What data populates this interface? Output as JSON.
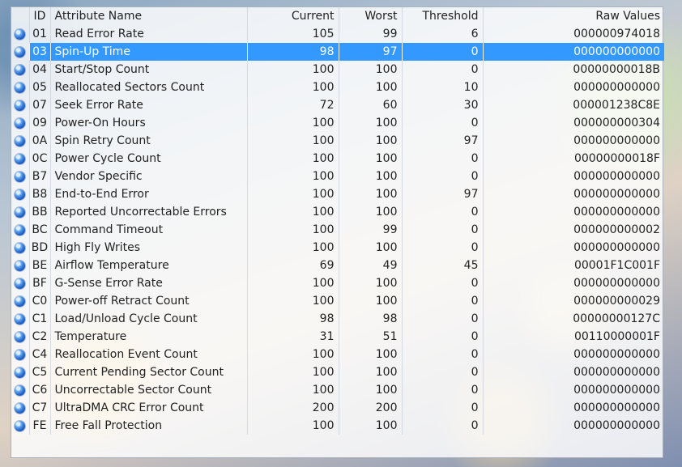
{
  "columns": {
    "id": "ID",
    "name": "Attribute Name",
    "current": "Current",
    "worst": "Worst",
    "threshold": "Threshold",
    "raw": "Raw Values"
  },
  "status_icon": "blue-status-dot",
  "selected_row": 1,
  "rows": [
    {
      "id": "01",
      "name": "Read Error Rate",
      "current": "105",
      "worst": "99",
      "threshold": "6",
      "raw": "000000974018"
    },
    {
      "id": "03",
      "name": "Spin-Up Time",
      "current": "98",
      "worst": "97",
      "threshold": "0",
      "raw": "000000000000"
    },
    {
      "id": "04",
      "name": "Start/Stop Count",
      "current": "100",
      "worst": "100",
      "threshold": "0",
      "raw": "00000000018B"
    },
    {
      "id": "05",
      "name": "Reallocated Sectors Count",
      "current": "100",
      "worst": "100",
      "threshold": "10",
      "raw": "000000000000"
    },
    {
      "id": "07",
      "name": "Seek Error Rate",
      "current": "72",
      "worst": "60",
      "threshold": "30",
      "raw": "000001238C8E"
    },
    {
      "id": "09",
      "name": "Power-On Hours",
      "current": "100",
      "worst": "100",
      "threshold": "0",
      "raw": "000000000304"
    },
    {
      "id": "0A",
      "name": "Spin Retry Count",
      "current": "100",
      "worst": "100",
      "threshold": "97",
      "raw": "000000000000"
    },
    {
      "id": "0C",
      "name": "Power Cycle Count",
      "current": "100",
      "worst": "100",
      "threshold": "0",
      "raw": "00000000018F"
    },
    {
      "id": "B7",
      "name": "Vendor Specific",
      "current": "100",
      "worst": "100",
      "threshold": "0",
      "raw": "000000000000"
    },
    {
      "id": "B8",
      "name": "End-to-End Error",
      "current": "100",
      "worst": "100",
      "threshold": "97",
      "raw": "000000000000"
    },
    {
      "id": "BB",
      "name": "Reported Uncorrectable Errors",
      "current": "100",
      "worst": "100",
      "threshold": "0",
      "raw": "000000000000"
    },
    {
      "id": "BC",
      "name": "Command Timeout",
      "current": "100",
      "worst": "99",
      "threshold": "0",
      "raw": "000000000002"
    },
    {
      "id": "BD",
      "name": "High Fly Writes",
      "current": "100",
      "worst": "100",
      "threshold": "0",
      "raw": "000000000000"
    },
    {
      "id": "BE",
      "name": "Airflow Temperature",
      "current": "69",
      "worst": "49",
      "threshold": "45",
      "raw": "00001F1C001F"
    },
    {
      "id": "BF",
      "name": "G-Sense Error Rate",
      "current": "100",
      "worst": "100",
      "threshold": "0",
      "raw": "000000000000"
    },
    {
      "id": "C0",
      "name": "Power-off Retract Count",
      "current": "100",
      "worst": "100",
      "threshold": "0",
      "raw": "000000000029"
    },
    {
      "id": "C1",
      "name": "Load/Unload Cycle Count",
      "current": "98",
      "worst": "98",
      "threshold": "0",
      "raw": "00000000127C"
    },
    {
      "id": "C2",
      "name": "Temperature",
      "current": "31",
      "worst": "51",
      "threshold": "0",
      "raw": "00110000001F"
    },
    {
      "id": "C4",
      "name": "Reallocation Event Count",
      "current": "100",
      "worst": "100",
      "threshold": "0",
      "raw": "000000000000"
    },
    {
      "id": "C5",
      "name": "Current Pending Sector Count",
      "current": "100",
      "worst": "100",
      "threshold": "0",
      "raw": "000000000000"
    },
    {
      "id": "C6",
      "name": "Uncorrectable Sector Count",
      "current": "100",
      "worst": "100",
      "threshold": "0",
      "raw": "000000000000"
    },
    {
      "id": "C7",
      "name": "UltraDMA CRC Error Count",
      "current": "200",
      "worst": "200",
      "threshold": "0",
      "raw": "000000000000"
    },
    {
      "id": "FE",
      "name": "Free Fall Protection",
      "current": "100",
      "worst": "100",
      "threshold": "0",
      "raw": "000000000000"
    }
  ]
}
